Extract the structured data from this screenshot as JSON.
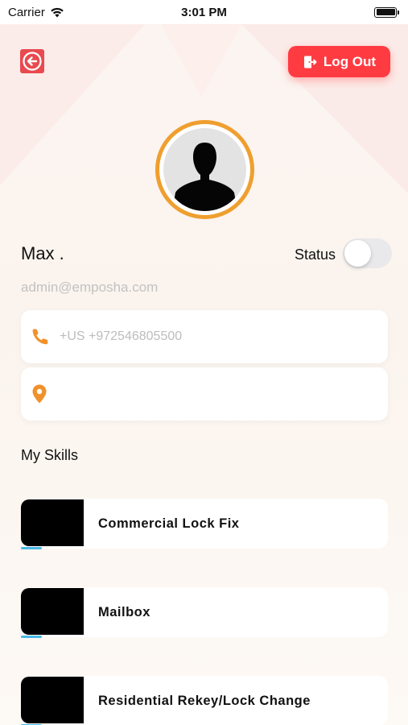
{
  "status_bar": {
    "carrier": "Carrier",
    "time": "3:01 PM"
  },
  "header": {
    "back_icon": "arrow-left-icon",
    "logout_label": "Log Out",
    "logout_icon": "logout-door-icon"
  },
  "profile": {
    "avatar_icon": "person-silhouette-icon",
    "name": "Max .",
    "status_label": "Status",
    "status_on": false,
    "email": "admin@emposha.com",
    "phone": "+US +972546805500",
    "location": ""
  },
  "skills": {
    "title": "My Skills",
    "items": [
      {
        "name": "Commercial Lock Fix"
      },
      {
        "name": "Mailbox"
      },
      {
        "name": "Residential Rekey/Lock Change"
      }
    ]
  },
  "colors": {
    "accent_red": "#ff3b42",
    "accent_orange": "#ef9f2f",
    "muted_text": "#c2c2c2"
  }
}
